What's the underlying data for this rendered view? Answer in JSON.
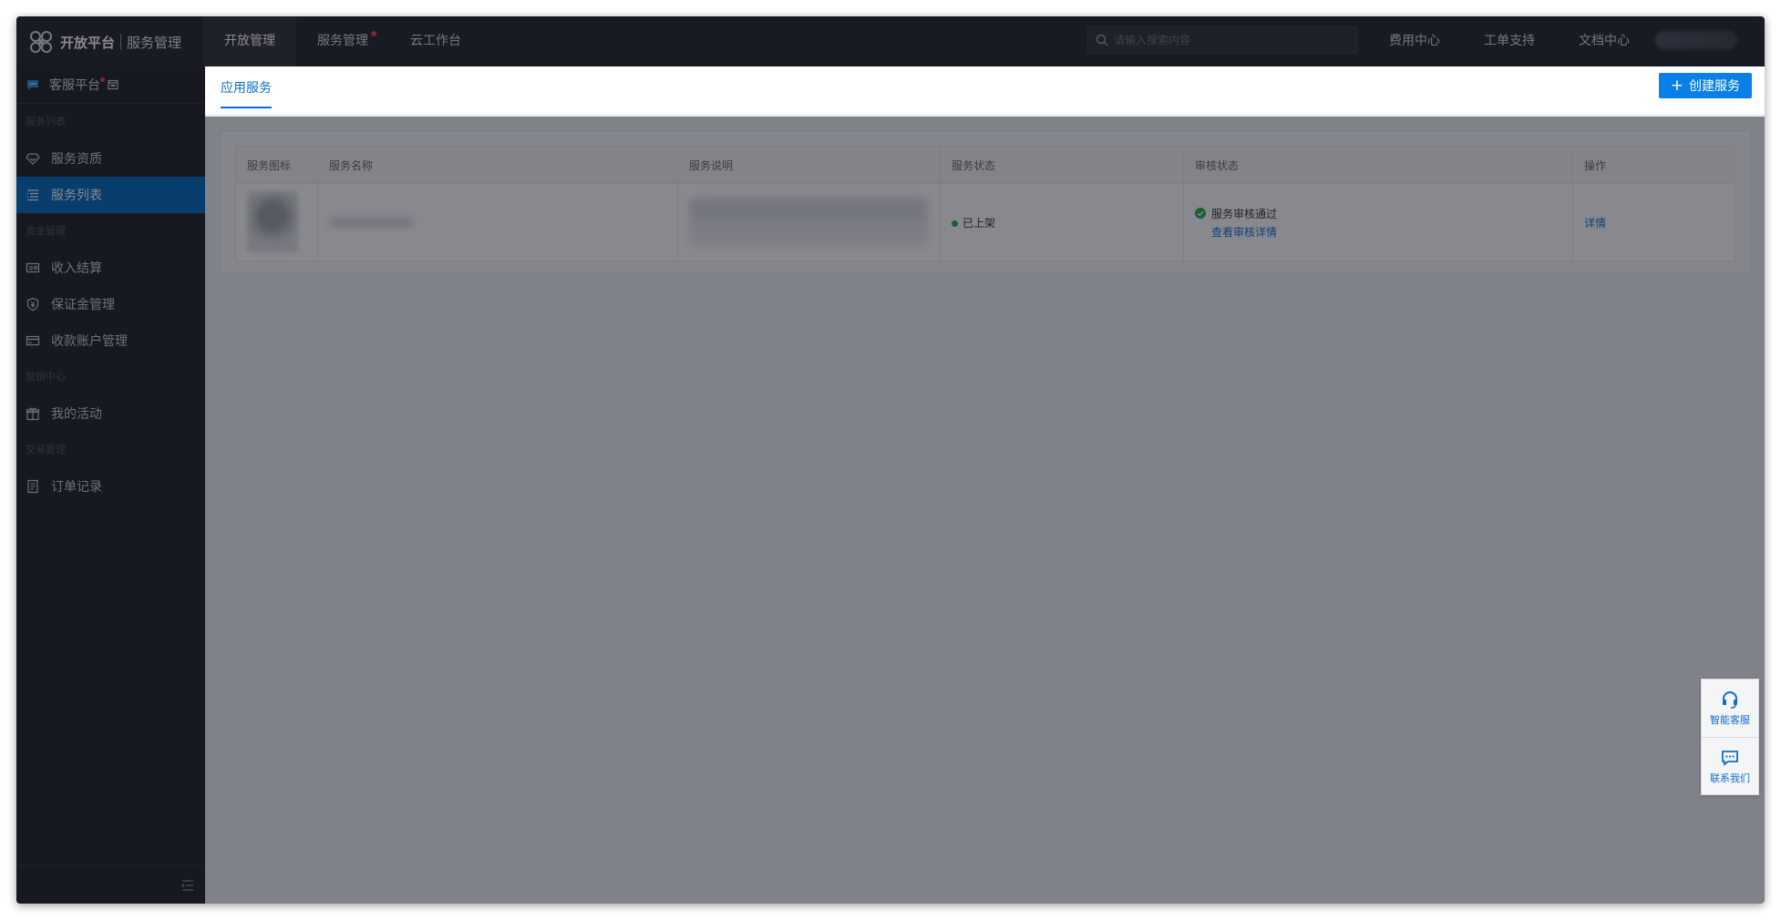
{
  "header": {
    "brand": "开放平台",
    "sub_title": "服务管理",
    "nav": [
      "开放管理",
      "服务管理",
      "云工作台"
    ],
    "active_nav_index": 0,
    "search_placeholder": "请输入搜索内容",
    "right_nav": [
      "费用中心",
      "工单支持",
      "文档中心"
    ]
  },
  "sidebar": {
    "platform_label": "客服平台",
    "groups": [
      {
        "title": "服务列表",
        "items": [
          {
            "label": "服务资质",
            "icon": "diamond-icon"
          },
          {
            "label": "服务列表",
            "icon": "list-icon",
            "active": true
          }
        ]
      },
      {
        "title": "资金管理",
        "items": [
          {
            "label": "收入结算",
            "icon": "settlement-icon"
          },
          {
            "label": "保证金管理",
            "icon": "shield-yen-icon"
          },
          {
            "label": "收款账户管理",
            "icon": "card-icon"
          }
        ]
      },
      {
        "title": "营销中心",
        "items": [
          {
            "label": "我的活动",
            "icon": "gift-icon"
          }
        ]
      },
      {
        "title": "交易管理",
        "items": [
          {
            "label": "订单记录",
            "icon": "document-icon"
          }
        ]
      }
    ]
  },
  "main": {
    "tab_label": "应用服务",
    "create_button_label": "创建服务",
    "table": {
      "columns": [
        "服务图标",
        "服务名称",
        "服务说明",
        "服务状态",
        "审核状态",
        "操作"
      ],
      "rows": [
        {
          "status": "已上架",
          "review_status": "服务审核通过",
          "review_link": "查看审核详情",
          "action": "详情"
        }
      ]
    }
  },
  "float_panel": {
    "smart_service_label": "智能客服",
    "contact_label": "联系我们"
  },
  "colors": {
    "accent": "#0a7fe8",
    "sidebar_active": "#0066b8",
    "topbar_bg": "#1f2229",
    "status_ok": "#28a745"
  }
}
